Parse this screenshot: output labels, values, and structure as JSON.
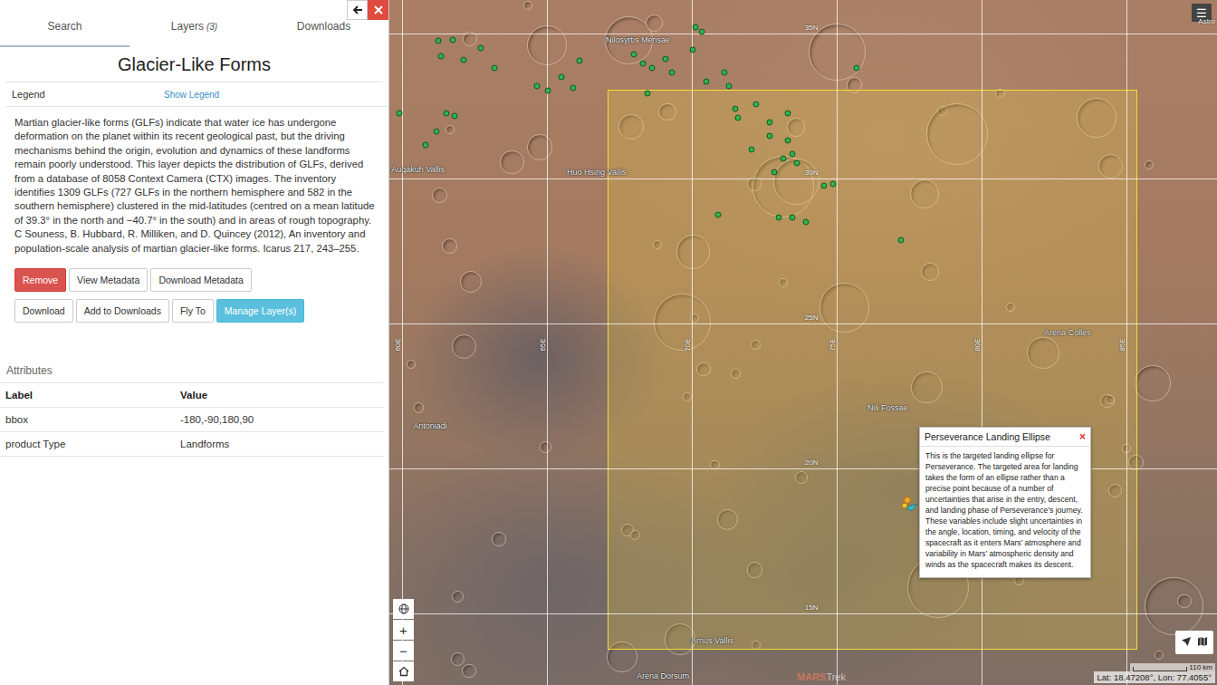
{
  "panel": {
    "tabs": [
      {
        "label": "Search",
        "selected": true
      },
      {
        "label": "Layers",
        "count": "(3)",
        "selected": false
      },
      {
        "label": "Downloads",
        "selected": false
      }
    ],
    "title": "Glacier-Like Forms",
    "legend": {
      "label": "Legend",
      "link": "Show Legend"
    },
    "description": "Martian glacier-like forms (GLFs) indicate that water ice has undergone deformation on the planet within its recent geological past, but the driving mechanisms behind the origin, evolution and dynamics of these landforms remain poorly understood. This layer depicts the distribution of GLFs, derived from a database of 8058 Context Camera (CTX) images. The inventory identifies 1309 GLFs (727 GLFs in the northern hemisphere and 582 in the southern hemisphere) clustered in the mid-latitudes (centred on a mean latitude of 39.3° in the north and −40.7° in the south) and in areas of rough topography. C Souness, B. Hubbard, R. Milliken, and D. Quincey (2012), An inventory and population-scale analysis of martian glacier-like forms. Icarus 217, 243–255.",
    "button_rows": [
      [
        {
          "label": "Remove",
          "kind": "danger"
        },
        {
          "label": "View Metadata",
          "kind": "default"
        },
        {
          "label": "Download Metadata",
          "kind": "default"
        }
      ],
      [
        {
          "label": "Download",
          "kind": "default"
        },
        {
          "label": "Add to Downloads",
          "kind": "default"
        },
        {
          "label": "Fly To",
          "kind": "default"
        },
        {
          "label": "Manage Layer(s)",
          "kind": "info"
        }
      ]
    ],
    "attributes": {
      "title": "Attributes",
      "columns": [
        "Label",
        "Value"
      ],
      "rows": [
        [
          "bbox",
          "-180,-90,180,90"
        ],
        [
          "product Type",
          "Landforms"
        ]
      ]
    }
  },
  "map": {
    "lat_lines": [
      {
        "label": "35N",
        "lat": 35
      },
      {
        "label": "30N",
        "lat": 30
      },
      {
        "label": "25N",
        "lat": 25
      },
      {
        "label": "20N",
        "lat": 20
      },
      {
        "label": "15N",
        "lat": 15
      }
    ],
    "lon_lines": [
      {
        "label": "60E",
        "lon": 60
      },
      {
        "label": "65E",
        "lon": 65
      },
      {
        "label": "70E",
        "lon": 70
      },
      {
        "label": "75E",
        "lon": 75
      },
      {
        "label": "80E",
        "lon": 80
      },
      {
        "label": "85E",
        "lon": 85
      }
    ],
    "places": [
      {
        "name": "Nilosyrtis Mensae",
        "lon": 67.03,
        "lat": 34.78
      },
      {
        "name": "Auqakuh Vallis",
        "lon": 59.63,
        "lat": 30.31
      },
      {
        "name": "Huo Hsing Vallis",
        "lon": 65.69,
        "lat": 30.22
      },
      {
        "name": "Arena Colles",
        "lon": 82.16,
        "lat": 24.69
      },
      {
        "name": "Antoniadi",
        "lon": 60.38,
        "lat": 21.47
      },
      {
        "name": "Nili Fossae",
        "lon": 76.06,
        "lat": 22.09
      },
      {
        "name": "Arnus Vallis",
        "lon": 69.97,
        "lat": 14.06
      },
      {
        "name": "Arena Dorsum",
        "lon": 68.09,
        "lat": 12.84
      }
    ],
    "footprint": {
      "west": 67.09,
      "east": 85.38,
      "north": 33.06,
      "south": 13.75
    },
    "glf_points": [
      [
        61.25,
        34.75
      ],
      [
        61.75,
        34.78
      ],
      [
        62.72,
        34.5
      ],
      [
        61.34,
        34.22
      ],
      [
        62.13,
        34.09
      ],
      [
        63.19,
        33.81
      ],
      [
        59.91,
        32.25
      ],
      [
        60.81,
        31.16
      ],
      [
        61.19,
        31.63
      ],
      [
        61.53,
        32.25
      ],
      [
        61.81,
        32.16
      ],
      [
        64.66,
        33.19
      ],
      [
        65.5,
        33.5
      ],
      [
        65.91,
        33.13
      ],
      [
        66.13,
        34.06
      ],
      [
        68.0,
        34.28
      ],
      [
        68.63,
        33.81
      ],
      [
        69.09,
        34.13
      ],
      [
        69.31,
        33.66
      ],
      [
        70.13,
        35.22
      ],
      [
        70.34,
        35.06
      ],
      [
        70.03,
        34.44
      ],
      [
        70.5,
        33.34
      ],
      [
        71.13,
        33.66
      ],
      [
        71.28,
        33.19
      ],
      [
        68.47,
        32.94
      ],
      [
        71.5,
        32.41
      ],
      [
        72.22,
        32.56
      ],
      [
        72.69,
        31.94
      ],
      [
        72.69,
        31.47
      ],
      [
        73.31,
        31.31
      ],
      [
        73.47,
        30.84
      ],
      [
        72.84,
        30.22
      ],
      [
        73.16,
        30.69
      ],
      [
        73.63,
        30.53
      ],
      [
        73.31,
        32.25
      ],
      [
        74.56,
        29.75
      ],
      [
        74.88,
        29.81
      ],
      [
        70.91,
        28.75
      ],
      [
        73.0,
        28.66
      ],
      [
        73.47,
        28.66
      ],
      [
        73.94,
        28.5
      ],
      [
        77.22,
        27.88
      ],
      [
        75.69,
        33.81
      ],
      [
        72.06,
        31.0
      ],
      [
        71.59,
        32.09
      ],
      [
        68.31,
        33.97
      ],
      [
        65.03,
        33.03
      ]
    ],
    "marker": {
      "lon": 77.47,
      "lat": 18.75
    },
    "popup": {
      "title": "Perseverance Landing Ellipse",
      "close": "×",
      "body": "This is the targeted landing ellipse for Perseverance. The targeted area for landing takes the form of an ellipse rather than a precise point because of a number of uncertainties that arise in the entry, descent, and landing phase of Perseverance’s journey. These variables include slight uncertainties in the angle, location, timing, and velocity of the spacecraft as it enters Mars’ atmosphere and variability in Mars’ atmospheric density and winds as the spacecraft makes its descent."
    },
    "zoom_in": "+",
    "zoom_out": "−",
    "menu": "☰",
    "corner_text": "Astro",
    "scale": "110 km",
    "coordinates": "Lat: 18.47208°, Lon: 77.4055°",
    "brand": {
      "bold": "MARS",
      "rest": "Trek"
    }
  }
}
